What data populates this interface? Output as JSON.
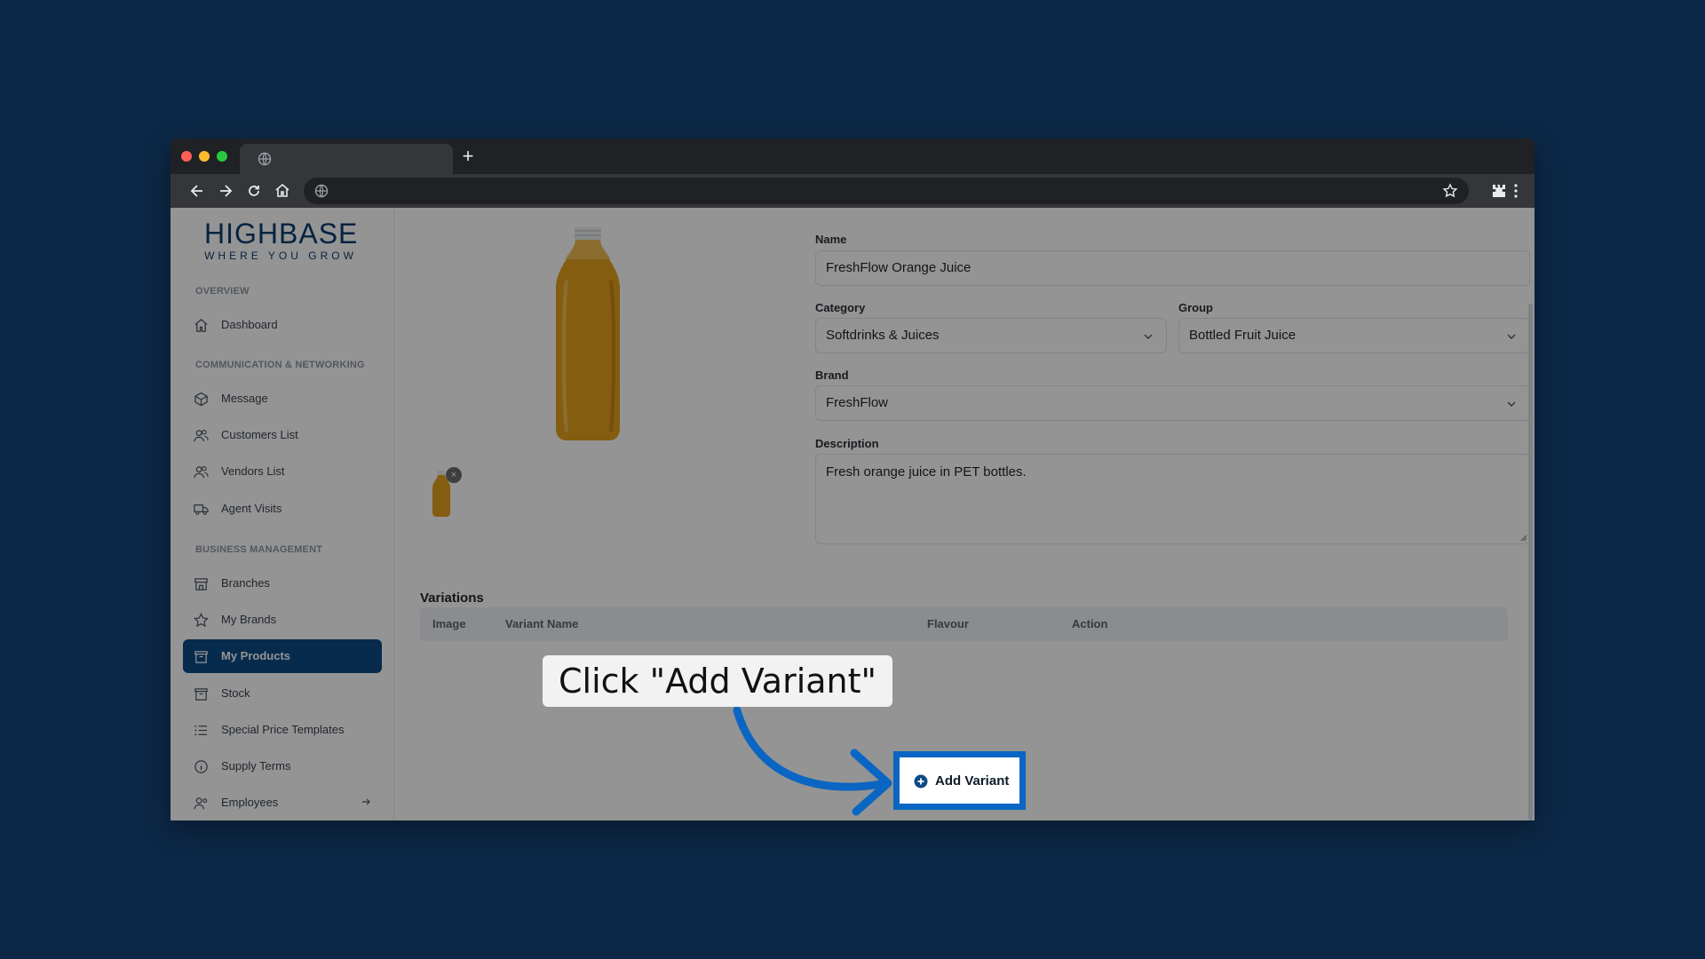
{
  "browser": {
    "new_tab_symbol": "+"
  },
  "sidebar": {
    "logo": {
      "name": "HIGHBASE",
      "tagline": "WHERE YOU GROW"
    },
    "sections": [
      {
        "label": "OVERVIEW"
      },
      {
        "label": "COMMUNICATION & NETWORKING"
      },
      {
        "label": "BUSINESS MANAGEMENT"
      }
    ],
    "items": [
      {
        "label": "Dashboard",
        "icon": "home-icon"
      },
      {
        "label": "Message",
        "icon": "cube-icon"
      },
      {
        "label": "Customers List",
        "icon": "users-icon"
      },
      {
        "label": "Vendors List",
        "icon": "users-icon"
      },
      {
        "label": "Agent Visits",
        "icon": "truck-icon"
      },
      {
        "label": "Branches",
        "icon": "store-icon"
      },
      {
        "label": "My Brands",
        "icon": "star-icon"
      },
      {
        "label": "My Products",
        "icon": "archive-icon",
        "active": true
      },
      {
        "label": "Stock",
        "icon": "archive-icon"
      },
      {
        "label": "Special Price Templates",
        "icon": "list-icon"
      },
      {
        "label": "Supply Terms",
        "icon": "info-icon"
      },
      {
        "label": "Employees",
        "icon": "users-gear-icon",
        "has_submenu": true
      }
    ]
  },
  "form": {
    "name_label": "Name",
    "name_value": "FreshFlow Orange Juice",
    "category_label": "Category",
    "category_value": "Softdrinks & Juices",
    "group_label": "Group",
    "group_value": "Bottled Fruit Juice",
    "brand_label": "Brand",
    "brand_value": "FreshFlow",
    "description_label": "Description",
    "description_value": "Fresh orange juice in PET bottles."
  },
  "variations": {
    "title": "Variations",
    "columns": [
      "Image",
      "Variant Name",
      "Flavour",
      "Action"
    ],
    "add_button": "Add Variant"
  },
  "callout": {
    "text": "Click \"Add Variant\""
  },
  "colors": {
    "background": "#0c2846",
    "accent": "#0a66c2",
    "active_nav": "#0c4a86",
    "juice": "#e3a11c"
  }
}
